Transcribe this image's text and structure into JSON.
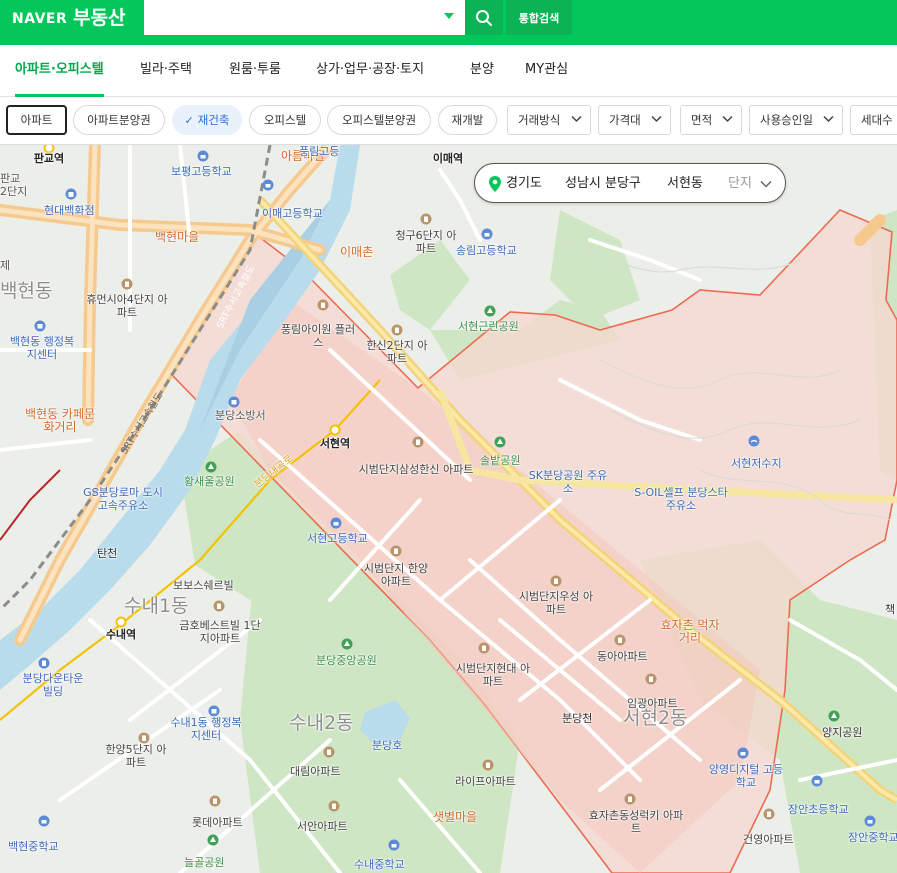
{
  "header": {
    "brand_naver": "NAVER",
    "brand_service": "부동산",
    "search_value": "",
    "search_placeholder": "",
    "unified_search_label": "통합검색",
    "accent_color": "#03c75a"
  },
  "tabs": [
    {
      "label": "아파트·오피스텔",
      "active": true
    },
    {
      "label": "빌라·주택"
    },
    {
      "label": "원룸·투룸"
    },
    {
      "label": "상가·업무·공장·토지"
    },
    {
      "label": "분양"
    },
    {
      "label": "MY관심"
    }
  ],
  "filters": {
    "chips": [
      "아파트",
      "아파트분양권",
      "재건축",
      "오피스텔",
      "오피스텔분양권",
      "재개발"
    ],
    "selected_chip": "아파트",
    "checked_chip": "재건축",
    "dropdowns": [
      "거래방식",
      "가격대",
      "면적",
      "사용승인일",
      "세대수"
    ]
  },
  "breadcrumb": {
    "province": "경기도",
    "city": "성남시 분당구",
    "dong": "서현동",
    "complex": "단지"
  },
  "map": {
    "highlight_color": "#f08c7a",
    "station_labels": [
      "판교역",
      "이매역",
      "서현역",
      "수내역"
    ],
    "district_labels": [
      "백현동",
      "수내1동",
      "수내2동",
      "서현2동"
    ],
    "orange_labels": [
      "아름마을",
      "백현마을",
      "이매촌",
      "백현동 카페문화거리",
      "효자촌 먹자거리",
      "샛별마을"
    ],
    "green_labels": [
      "서현근린공원",
      "솔밭공원",
      "황새울공원",
      "분당중앙공원",
      "양지공원",
      "늘골공원"
    ],
    "blue_labels": [
      "보평고등학교",
      "현대백화점",
      "이매고등학교",
      "송림고등학교",
      "서현고등학교",
      "분당소방서",
      "서현저수지",
      "백현동 행정복지센터",
      "분당다운타운 빌딩",
      "수내1동 행정복지센터",
      "분당호",
      "양영디지털 고등학교",
      "장안초등학교",
      "장안중학교",
      "백현중학교",
      "수내중학교",
      "SK분당공원 주유소",
      "S-OIL셀프 분당스타주유소",
      "GS분당로마 도시고속주유소",
      "판교 2단지",
      "제"
    ],
    "apartment_labels": [
      "휴먼시아4단지 아파트",
      "청구6단지 아파트",
      "풍림아이원 플러스",
      "한신2단지 아파트",
      "시범단지삼성한신 아파트",
      "시범단지 한양아파트",
      "시범단지우성 아파트",
      "시범단지현대 아파트",
      "동아아파트",
      "임광아파트",
      "보보스쉐르빌",
      "금호베스트빌 1단지아파트",
      "한양5단지 아파트",
      "대림아파트",
      "라이프아파트",
      "롯데아파트",
      "서안아파트",
      "효자촌동성럭키 아파트",
      "건영아파트",
      "풍림고등"
    ],
    "road_labels": [
      "분당천",
      "탄천",
      "분당내곡로"
    ],
    "rail_labels": [
      "SRT수서고속철도",
      "SRT수서고속철도"
    ],
    "misc_labels": [
      "책"
    ]
  }
}
